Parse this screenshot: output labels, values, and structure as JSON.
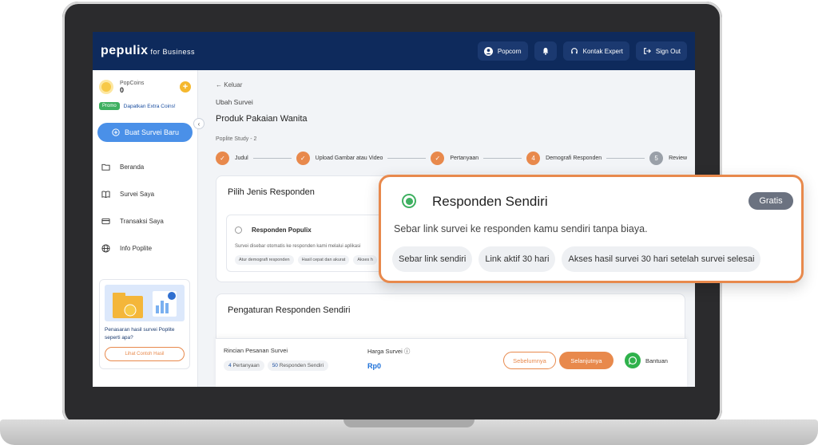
{
  "app": {
    "logo": "pepulix",
    "logo_suffix": "for Business"
  },
  "topbar": {
    "user": "Popcorn",
    "contact": "Kontak Expert",
    "signout": "Sign Out"
  },
  "sidebar": {
    "coins_label": "PopCoins",
    "coins_value": "0",
    "promo_badge": "Promo",
    "promo_link": "Dapatkan Extra Coins!",
    "new_survey": "Buat Survei Baru",
    "items": [
      {
        "label": "Beranda"
      },
      {
        "label": "Survei Saya"
      },
      {
        "label": "Transaksi Saya"
      },
      {
        "label": "Info Poplite"
      }
    ],
    "promo_card_text": "Penasaran hasil survei Poplite seperti apa?",
    "promo_card_btn": "Lihat Contoh Hasil"
  },
  "main": {
    "back": "Keluar",
    "subtitle": "Ubah Survei",
    "title": "Produk Pakaian Wanita",
    "study": "Poplite Study - 2",
    "steps": [
      {
        "label": "Judul",
        "num": ""
      },
      {
        "label": "Upload Gambar atau Video",
        "num": ""
      },
      {
        "label": "Pertanyaan",
        "num": ""
      },
      {
        "label": "Demografi Responden",
        "num": "4"
      },
      {
        "label": "Review",
        "num": "5"
      }
    ],
    "card1_title": "Pilih Jenis Responden",
    "option_title": "Responden Populix",
    "option_desc": "Survei disebar otomatis ke responden kami melalui aplikasi",
    "option_chips": [
      "Atur demografi responden",
      "Hasil cepat dan akurat",
      "Akses h"
    ],
    "card2_title": "Pengaturan Responden Sendiri"
  },
  "bottombar": {
    "summary_label": "Rincian Pesanan Survei",
    "tag1_num": "4",
    "tag1_text": "Pertanyaan",
    "tag2_num": "50",
    "tag2_text": "Responden Sendiri",
    "price_label": "Harga Survei",
    "price": "Rp0",
    "prev": "Sebelumnya",
    "next": "Selanjutnya",
    "help": "Bantuan"
  },
  "zoom": {
    "title": "Responden Sendiri",
    "badge": "Gratis",
    "desc": "Sebar link survei ke responden kamu sendiri tanpa biaya.",
    "chips": [
      "Sebar link sendiri",
      "Link aktif 30 hari",
      "Akses hasil survei 30 hari setelah survei selesai"
    ]
  },
  "colors": {
    "accent": "#e8894c",
    "navy": "#0e2a5c",
    "primary_blue": "#4a90e8",
    "green": "#3fb061"
  }
}
